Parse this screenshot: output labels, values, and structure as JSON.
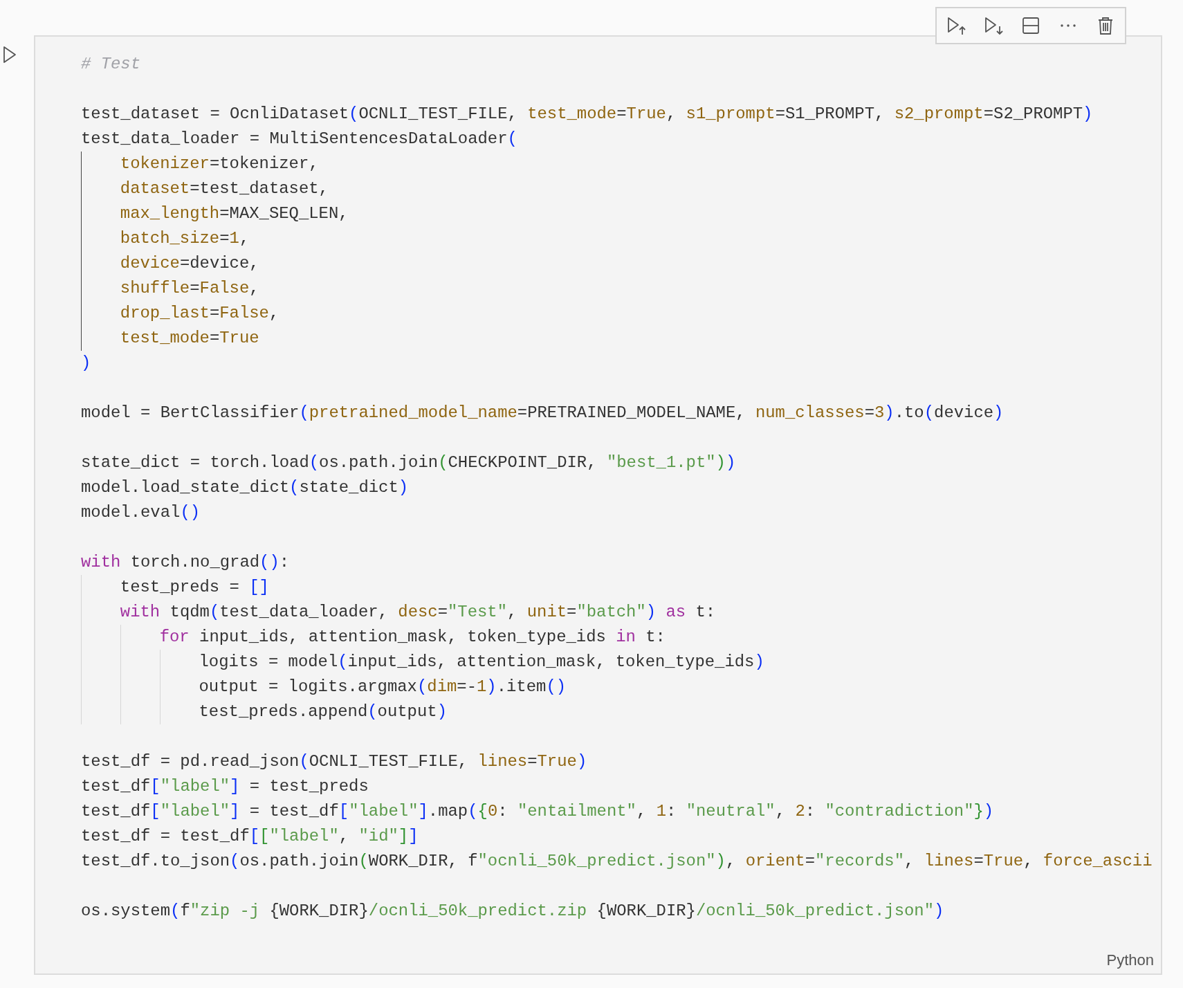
{
  "cell": {
    "language": "Python",
    "lines": [
      {
        "kind": "code",
        "tokens": [
          {
            "text": "# Test",
            "kind": "comment"
          }
        ]
      },
      {
        "kind": "blank"
      },
      {
        "kind": "code",
        "tokens": [
          {
            "text": "test_dataset = OcnliDataset",
            "kind": "plain"
          },
          {
            "text": "(",
            "kind": "bracket1"
          },
          {
            "text": "OCNLI_TEST_FILE, ",
            "kind": "plain"
          },
          {
            "text": "test_mode",
            "kind": "param"
          },
          {
            "text": "=",
            "kind": "plain"
          },
          {
            "text": "True",
            "kind": "literal"
          },
          {
            "text": ", ",
            "kind": "plain"
          },
          {
            "text": "s1_prompt",
            "kind": "param"
          },
          {
            "text": "=S1_PROMPT, ",
            "kind": "plain"
          },
          {
            "text": "s2_prompt",
            "kind": "param"
          },
          {
            "text": "=S2_PROMPT",
            "kind": "plain"
          },
          {
            "text": ")",
            "kind": "bracket1"
          }
        ]
      },
      {
        "kind": "code",
        "tokens": [
          {
            "text": "test_data_loader = MultiSentencesDataLoader",
            "kind": "plain"
          },
          {
            "text": "(",
            "kind": "bracket1"
          }
        ],
        "guide_active": true,
        "children": [
          {
            "kind": "code",
            "tokens": [
              {
                "text": "tokenizer",
                "kind": "param"
              },
              {
                "text": "=tokenizer,",
                "kind": "plain"
              }
            ]
          },
          {
            "kind": "code",
            "tokens": [
              {
                "text": "dataset",
                "kind": "param"
              },
              {
                "text": "=test_dataset,",
                "kind": "plain"
              }
            ]
          },
          {
            "kind": "code",
            "tokens": [
              {
                "text": "max_length",
                "kind": "param"
              },
              {
                "text": "=MAX_SEQ_LEN,",
                "kind": "plain"
              }
            ]
          },
          {
            "kind": "code",
            "tokens": [
              {
                "text": "batch_size",
                "kind": "param"
              },
              {
                "text": "=",
                "kind": "plain"
              },
              {
                "text": "1",
                "kind": "literal"
              },
              {
                "text": ",",
                "kind": "plain"
              }
            ]
          },
          {
            "kind": "code",
            "tokens": [
              {
                "text": "device",
                "kind": "param"
              },
              {
                "text": "=device,",
                "kind": "plain"
              }
            ]
          },
          {
            "kind": "code",
            "tokens": [
              {
                "text": "shuffle",
                "kind": "param"
              },
              {
                "text": "=",
                "kind": "plain"
              },
              {
                "text": "False",
                "kind": "literal"
              },
              {
                "text": ",",
                "kind": "plain"
              }
            ]
          },
          {
            "kind": "code",
            "tokens": [
              {
                "text": "drop_last",
                "kind": "param"
              },
              {
                "text": "=",
                "kind": "plain"
              },
              {
                "text": "False",
                "kind": "literal"
              },
              {
                "text": ",",
                "kind": "plain"
              }
            ]
          },
          {
            "kind": "code",
            "tokens": [
              {
                "text": "test_mode",
                "kind": "param"
              },
              {
                "text": "=",
                "kind": "plain"
              },
              {
                "text": "True",
                "kind": "literal"
              }
            ]
          }
        ]
      },
      {
        "kind": "code",
        "tokens": [
          {
            "text": ")",
            "kind": "bracket1"
          }
        ]
      },
      {
        "kind": "blank"
      },
      {
        "kind": "code",
        "tokens": [
          {
            "text": "model = BertClassifier",
            "kind": "plain"
          },
          {
            "text": "(",
            "kind": "bracket1"
          },
          {
            "text": "pretrained_model_name",
            "kind": "param"
          },
          {
            "text": "=PRETRAINED_MODEL_NAME, ",
            "kind": "plain"
          },
          {
            "text": "num_classes",
            "kind": "param"
          },
          {
            "text": "=",
            "kind": "plain"
          },
          {
            "text": "3",
            "kind": "literal"
          },
          {
            "text": ")",
            "kind": "bracket1"
          },
          {
            "text": ".to",
            "kind": "plain"
          },
          {
            "text": "(",
            "kind": "bracket1"
          },
          {
            "text": "device",
            "kind": "plain"
          },
          {
            "text": ")",
            "kind": "bracket1"
          }
        ]
      },
      {
        "kind": "blank"
      },
      {
        "kind": "code",
        "tokens": [
          {
            "text": "state_dict = torch.load",
            "kind": "plain"
          },
          {
            "text": "(",
            "kind": "bracket1"
          },
          {
            "text": "os.path.join",
            "kind": "plain"
          },
          {
            "text": "(",
            "kind": "bracket2"
          },
          {
            "text": "CHECKPOINT_DIR, ",
            "kind": "plain"
          },
          {
            "text": "\"best_1.pt\"",
            "kind": "string"
          },
          {
            "text": ")",
            "kind": "bracket2"
          },
          {
            "text": ")",
            "kind": "bracket1"
          }
        ]
      },
      {
        "kind": "code",
        "tokens": [
          {
            "text": "model.load_state_dict",
            "kind": "plain"
          },
          {
            "text": "(",
            "kind": "bracket1"
          },
          {
            "text": "state_dict",
            "kind": "plain"
          },
          {
            "text": ")",
            "kind": "bracket1"
          }
        ]
      },
      {
        "kind": "code",
        "tokens": [
          {
            "text": "model.eval",
            "kind": "plain"
          },
          {
            "text": "()",
            "kind": "bracket1"
          }
        ]
      },
      {
        "kind": "blank"
      },
      {
        "kind": "code",
        "tokens": [
          {
            "text": "with",
            "kind": "keyword"
          },
          {
            "text": " torch.no_grad",
            "kind": "plain"
          },
          {
            "text": "()",
            "kind": "bracket1"
          },
          {
            "text": ":",
            "kind": "plain"
          }
        ],
        "guide_active": false,
        "children": [
          {
            "kind": "code",
            "tokens": [
              {
                "text": "test_preds = ",
                "kind": "plain"
              },
              {
                "text": "[]",
                "kind": "bracket1"
              }
            ]
          },
          {
            "kind": "code",
            "tokens": [
              {
                "text": "with",
                "kind": "keyword"
              },
              {
                "text": " tqdm",
                "kind": "plain"
              },
              {
                "text": "(",
                "kind": "bracket1"
              },
              {
                "text": "test_data_loader, ",
                "kind": "plain"
              },
              {
                "text": "desc",
                "kind": "param"
              },
              {
                "text": "=",
                "kind": "plain"
              },
              {
                "text": "\"Test\"",
                "kind": "string"
              },
              {
                "text": ", ",
                "kind": "plain"
              },
              {
                "text": "unit",
                "kind": "param"
              },
              {
                "text": "=",
                "kind": "plain"
              },
              {
                "text": "\"batch\"",
                "kind": "string"
              },
              {
                "text": ")",
                "kind": "bracket1"
              },
              {
                "text": " as",
                "kind": "keyword"
              },
              {
                "text": " t:",
                "kind": "plain"
              }
            ],
            "guide_active": false,
            "children": [
              {
                "kind": "code",
                "tokens": [
                  {
                    "text": "for",
                    "kind": "keyword"
                  },
                  {
                    "text": " input_ids, attention_mask, token_type_ids ",
                    "kind": "plain"
                  },
                  {
                    "text": "in",
                    "kind": "keyword"
                  },
                  {
                    "text": " t:",
                    "kind": "plain"
                  }
                ],
                "guide_active": false,
                "children": [
                  {
                    "kind": "code",
                    "tokens": [
                      {
                        "text": "logits = model",
                        "kind": "plain"
                      },
                      {
                        "text": "(",
                        "kind": "bracket1"
                      },
                      {
                        "text": "input_ids, attention_mask, token_type_ids",
                        "kind": "plain"
                      },
                      {
                        "text": ")",
                        "kind": "bracket1"
                      }
                    ]
                  },
                  {
                    "kind": "code",
                    "tokens": [
                      {
                        "text": "output = logits.argmax",
                        "kind": "plain"
                      },
                      {
                        "text": "(",
                        "kind": "bracket1"
                      },
                      {
                        "text": "dim",
                        "kind": "param"
                      },
                      {
                        "text": "=-",
                        "kind": "plain"
                      },
                      {
                        "text": "1",
                        "kind": "literal"
                      },
                      {
                        "text": ")",
                        "kind": "bracket1"
                      },
                      {
                        "text": ".item",
                        "kind": "plain"
                      },
                      {
                        "text": "()",
                        "kind": "bracket1"
                      }
                    ]
                  },
                  {
                    "kind": "code",
                    "tokens": [
                      {
                        "text": "test_preds.append",
                        "kind": "plain"
                      },
                      {
                        "text": "(",
                        "kind": "bracket1"
                      },
                      {
                        "text": "output",
                        "kind": "plain"
                      },
                      {
                        "text": ")",
                        "kind": "bracket1"
                      }
                    ]
                  }
                ]
              }
            ]
          }
        ]
      },
      {
        "kind": "blank"
      },
      {
        "kind": "code",
        "tokens": [
          {
            "text": "test_df = pd.read_json",
            "kind": "plain"
          },
          {
            "text": "(",
            "kind": "bracket1"
          },
          {
            "text": "OCNLI_TEST_FILE, ",
            "kind": "plain"
          },
          {
            "text": "lines",
            "kind": "param"
          },
          {
            "text": "=",
            "kind": "plain"
          },
          {
            "text": "True",
            "kind": "literal"
          },
          {
            "text": ")",
            "kind": "bracket1"
          }
        ]
      },
      {
        "kind": "code",
        "tokens": [
          {
            "text": "test_df",
            "kind": "plain"
          },
          {
            "text": "[",
            "kind": "bracket1"
          },
          {
            "text": "\"label\"",
            "kind": "string"
          },
          {
            "text": "]",
            "kind": "bracket1"
          },
          {
            "text": " = test_preds",
            "kind": "plain"
          }
        ]
      },
      {
        "kind": "code",
        "tokens": [
          {
            "text": "test_df",
            "kind": "plain"
          },
          {
            "text": "[",
            "kind": "bracket1"
          },
          {
            "text": "\"label\"",
            "kind": "string"
          },
          {
            "text": "]",
            "kind": "bracket1"
          },
          {
            "text": " = test_df",
            "kind": "plain"
          },
          {
            "text": "[",
            "kind": "bracket1"
          },
          {
            "text": "\"label\"",
            "kind": "string"
          },
          {
            "text": "]",
            "kind": "bracket1"
          },
          {
            "text": ".map",
            "kind": "plain"
          },
          {
            "text": "(",
            "kind": "bracket1"
          },
          {
            "text": "{",
            "kind": "bracket2"
          },
          {
            "text": "0",
            "kind": "literal"
          },
          {
            "text": ": ",
            "kind": "plain"
          },
          {
            "text": "\"entailment\"",
            "kind": "string"
          },
          {
            "text": ", ",
            "kind": "plain"
          },
          {
            "text": "1",
            "kind": "literal"
          },
          {
            "text": ": ",
            "kind": "plain"
          },
          {
            "text": "\"neutral\"",
            "kind": "string"
          },
          {
            "text": ", ",
            "kind": "plain"
          },
          {
            "text": "2",
            "kind": "literal"
          },
          {
            "text": ": ",
            "kind": "plain"
          },
          {
            "text": "\"contradiction\"",
            "kind": "string"
          },
          {
            "text": "}",
            "kind": "bracket2"
          },
          {
            "text": ")",
            "kind": "bracket1"
          }
        ]
      },
      {
        "kind": "code",
        "tokens": [
          {
            "text": "test_df = test_df",
            "kind": "plain"
          },
          {
            "text": "[",
            "kind": "bracket1"
          },
          {
            "text": "[",
            "kind": "bracket2"
          },
          {
            "text": "\"label\"",
            "kind": "string"
          },
          {
            "text": ", ",
            "kind": "plain"
          },
          {
            "text": "\"id\"",
            "kind": "string"
          },
          {
            "text": "]",
            "kind": "bracket2"
          },
          {
            "text": "]",
            "kind": "bracket1"
          }
        ]
      },
      {
        "kind": "code",
        "tokens": [
          {
            "text": "test_df.to_json",
            "kind": "plain"
          },
          {
            "text": "(",
            "kind": "bracket1"
          },
          {
            "text": "os.path.join",
            "kind": "plain"
          },
          {
            "text": "(",
            "kind": "bracket2"
          },
          {
            "text": "WORK_DIR, f",
            "kind": "plain"
          },
          {
            "text": "\"ocnli_50k_predict.json\"",
            "kind": "string"
          },
          {
            "text": ")",
            "kind": "bracket2"
          },
          {
            "text": ", ",
            "kind": "plain"
          },
          {
            "text": "orient",
            "kind": "param"
          },
          {
            "text": "=",
            "kind": "plain"
          },
          {
            "text": "\"records\"",
            "kind": "string"
          },
          {
            "text": ", ",
            "kind": "plain"
          },
          {
            "text": "lines",
            "kind": "param"
          },
          {
            "text": "=",
            "kind": "plain"
          },
          {
            "text": "True",
            "kind": "literal"
          },
          {
            "text": ", ",
            "kind": "plain"
          },
          {
            "text": "force_ascii",
            "kind": "param"
          }
        ]
      },
      {
        "kind": "blank"
      },
      {
        "kind": "code",
        "tokens": [
          {
            "text": "os.system",
            "kind": "plain"
          },
          {
            "text": "(",
            "kind": "bracket1"
          },
          {
            "text": "f",
            "kind": "plain"
          },
          {
            "text": "\"zip -j ",
            "kind": "string"
          },
          {
            "text": "{WORK_DIR}",
            "kind": "plain"
          },
          {
            "text": "/ocnli_50k_predict.zip ",
            "kind": "string"
          },
          {
            "text": "{WORK_DIR}",
            "kind": "plain"
          },
          {
            "text": "/ocnli_50k_predict.json\"",
            "kind": "string"
          },
          {
            "text": ")",
            "kind": "bracket1"
          }
        ]
      }
    ]
  }
}
